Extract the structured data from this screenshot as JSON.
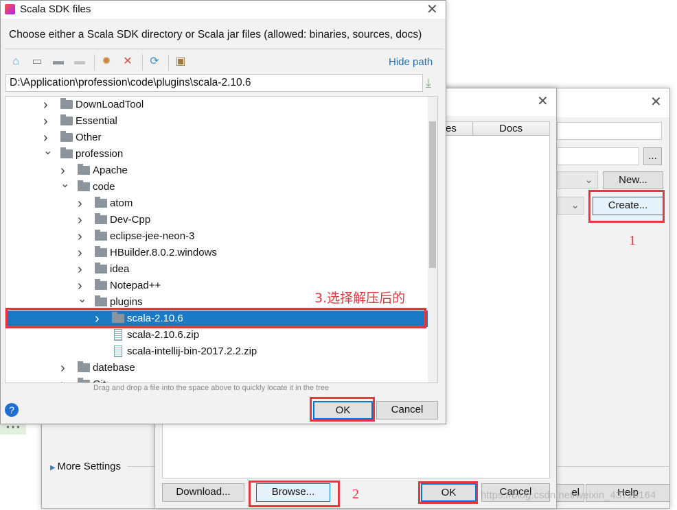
{
  "back_dialog": {
    "new_label": "New...",
    "create_label": "Create...",
    "browse_dots": "...",
    "more_settings": "More Settings",
    "cancel_partial": "el",
    "help_label": "Help"
  },
  "middle_dialog": {
    "col_partial": "es",
    "col_docs": "Docs",
    "download_label": "Download...",
    "browse_label": "Browse...",
    "ok_label": "OK",
    "cancel_label": "Cancel"
  },
  "front_dialog": {
    "title": "Scala SDK files",
    "subtitle": "Choose either a Scala SDK directory or Scala jar files (allowed: binaries, sources, docs)",
    "hide_path": "Hide path",
    "path": "D:\\Application\\profession\\code\\plugins\\scala-2.10.6",
    "hint": "Drag and drop a file into the space above to quickly locate it in the tree",
    "ok_label": "OK",
    "cancel_label": "Cancel",
    "toolbar": [
      "home-icon",
      "desktop-icon",
      "module-icon",
      "project-icon",
      "new-folder-icon",
      "delete-icon",
      "refresh-icon",
      "show-hidden-icon"
    ],
    "tree": [
      {
        "label": "DownLoadTool",
        "depth": 0,
        "type": "folder",
        "exp": false
      },
      {
        "label": "Essential",
        "depth": 0,
        "type": "folder",
        "exp": false
      },
      {
        "label": "Other",
        "depth": 0,
        "type": "folder",
        "exp": false
      },
      {
        "label": "profession",
        "depth": 0,
        "type": "folder",
        "exp": true
      },
      {
        "label": "Apache",
        "depth": 1,
        "type": "folder",
        "exp": false
      },
      {
        "label": "code",
        "depth": 1,
        "type": "folder",
        "exp": true
      },
      {
        "label": "atom",
        "depth": 2,
        "type": "folder",
        "exp": false
      },
      {
        "label": "Dev-Cpp",
        "depth": 2,
        "type": "folder",
        "exp": false
      },
      {
        "label": "eclipse-jee-neon-3",
        "depth": 2,
        "type": "folder",
        "exp": false
      },
      {
        "label": "HBuilder.8.0.2.windows",
        "depth": 2,
        "type": "folder",
        "exp": false
      },
      {
        "label": "idea",
        "depth": 2,
        "type": "folder",
        "exp": false
      },
      {
        "label": "Notepad++",
        "depth": 2,
        "type": "folder",
        "exp": false
      },
      {
        "label": "plugins",
        "depth": 2,
        "type": "folder",
        "exp": true
      },
      {
        "label": "scala-2.10.6",
        "depth": 3,
        "type": "folder",
        "exp": false,
        "selected": true
      },
      {
        "label": "scala-2.10.6.zip",
        "depth": 3,
        "type": "zip"
      },
      {
        "label": "scala-intellij-bin-2017.2.2.zip",
        "depth": 3,
        "type": "zip"
      },
      {
        "label": "datebase",
        "depth": 1,
        "type": "folder",
        "exp": false
      },
      {
        "label": "Git",
        "depth": 1,
        "type": "folder",
        "exp": false
      }
    ]
  },
  "annotations": {
    "step1": "1",
    "step2": "2",
    "step3": "3.选择解压后的",
    "watermark": "https://blog.csdn.net/weixin_43716164"
  },
  "colors": {
    "selection": "#1a7bc4",
    "annotation": "#e8363c",
    "link": "#2470b3"
  }
}
